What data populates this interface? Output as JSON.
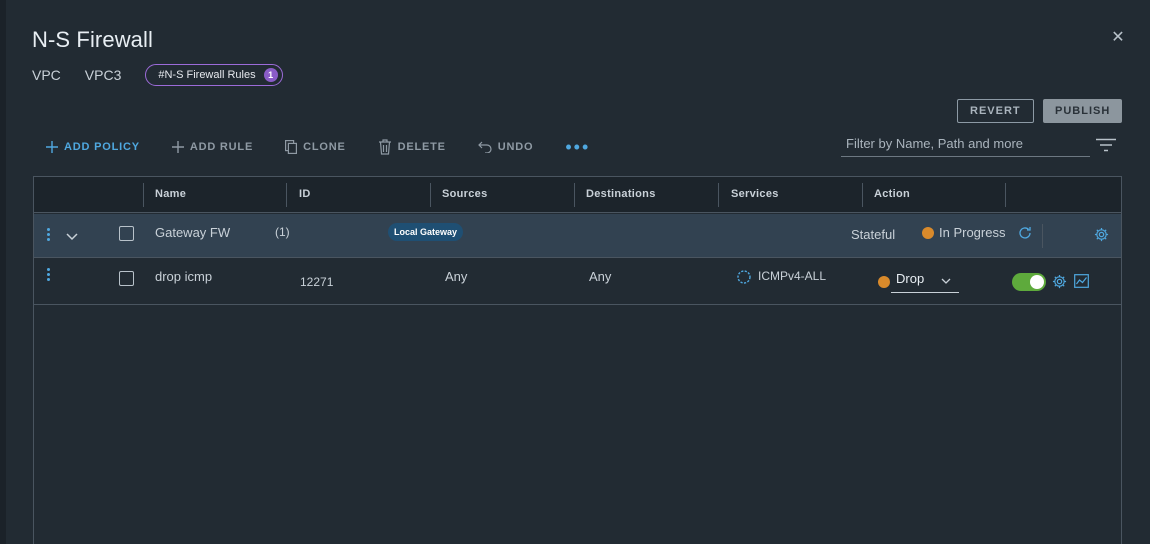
{
  "dialog": {
    "title": "N-S Firewall",
    "close_glyph": "✕"
  },
  "breadcrumb": {
    "items": [
      "VPC",
      "VPC3"
    ],
    "pill_label": "#N-S Firewall Rules",
    "pill_count": "1"
  },
  "actions": {
    "revert": "REVERT",
    "publish": "PUBLISH"
  },
  "toolbar": {
    "add_policy": "ADD POLICY",
    "add_rule": "ADD RULE",
    "clone": "CLONE",
    "delete": "DELETE",
    "undo": "UNDO",
    "more": "•••"
  },
  "filter": {
    "placeholder": "Filter by Name, Path and more"
  },
  "table": {
    "columns": [
      "Name",
      "ID",
      "Sources",
      "Destinations",
      "Services",
      "Action"
    ],
    "policy": {
      "name": "Gateway FW",
      "rule_count": "(1)",
      "tag": "Local Gateway",
      "mode": "Stateful",
      "status": "In Progress"
    },
    "rules": [
      {
        "name": "drop icmp",
        "id": "12271",
        "sources": "Any",
        "destinations": "Any",
        "services": "ICMPv4-ALL",
        "action": "Drop",
        "enabled": true
      }
    ]
  },
  "colors": {
    "accent": "#4fa8e0",
    "status_in_progress": "#d98a2b",
    "toggle_on": "#5eaa3c",
    "pill_border": "#9c6bd9"
  },
  "icons": {
    "close": "close-icon",
    "add": "plus-icon",
    "clone": "clone-icon",
    "delete": "trash-icon",
    "undo": "undo-icon",
    "filter": "filter-icon",
    "refresh": "refresh-icon",
    "settings": "gear-icon",
    "stats": "chart-icon",
    "service": "service-icon",
    "expand": "chevron-down-icon"
  }
}
